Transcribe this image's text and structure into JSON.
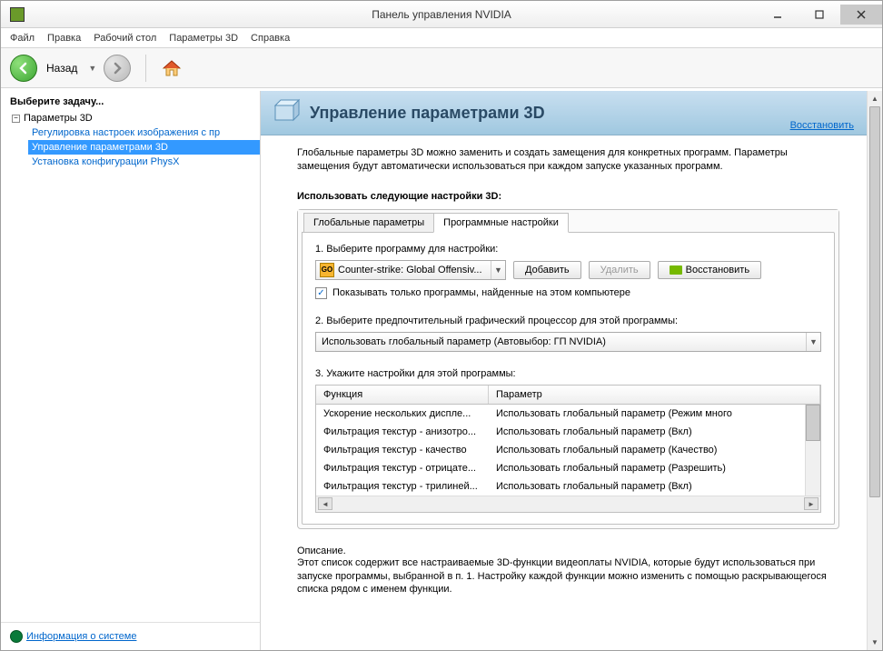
{
  "window": {
    "title": "Панель управления NVIDIA"
  },
  "menu": [
    "Файл",
    "Правка",
    "Рабочий стол",
    "Параметры 3D",
    "Справка"
  ],
  "toolbar": {
    "back": "Назад"
  },
  "sidebar": {
    "title": "Выберите задачу...",
    "root": "Параметры 3D",
    "items": [
      "Регулировка настроек изображения с пр",
      "Управление параметрами 3D",
      "Установка конфигурации PhysX"
    ],
    "sysinfo": "Информация о системе"
  },
  "header": {
    "title": "Управление параметрами 3D",
    "restore": "Восстановить"
  },
  "body": {
    "intro": "Глобальные параметры 3D можно заменить и создать замещения для конкретных программ. Параметры замещения будут автоматически использоваться при каждом запуске указанных программ.",
    "use_label": "Использовать следующие настройки 3D:",
    "tabs": [
      "Глобальные параметры",
      "Программные настройки"
    ],
    "step1": "1. Выберите программу для настройки:",
    "program": "Counter-strike: Global Offensiv...",
    "add": "Добавить",
    "remove": "Удалить",
    "restore": "Восстановить",
    "show_only": "Показывать только программы, найденные на этом компьютере",
    "step2": "2. Выберите предпочтительный графический процессор для этой программы:",
    "gpu": "Использовать глобальный параметр (Автовыбор: ГП NVIDIA)",
    "step3": "3. Укажите настройки для этой программы:",
    "col_func": "Функция",
    "col_param": "Параметр",
    "rows": [
      {
        "f": "Ускорение нескольких диспле...",
        "p": "Использовать глобальный параметр (Режим много"
      },
      {
        "f": "Фильтрация текстур - анизотро...",
        "p": "Использовать глобальный параметр (Вкл)"
      },
      {
        "f": "Фильтрация текстур - качество",
        "p": "Использовать глобальный параметр (Качество)"
      },
      {
        "f": "Фильтрация текстур - отрицате...",
        "p": "Использовать глобальный параметр (Разрешить)"
      },
      {
        "f": "Фильтрация текстур - трилиней...",
        "p": "Использовать глобальный параметр (Вкл)"
      }
    ]
  },
  "desc": {
    "title": "Описание.",
    "text": "Этот список содержит все настраиваемые 3D-функции видеоплаты NVIDIA, которые будут использоваться при запуске программы, выбранной в п. 1. Настройку каждой функции можно изменить с помощью раскрывающегося списка рядом с именем функции."
  }
}
